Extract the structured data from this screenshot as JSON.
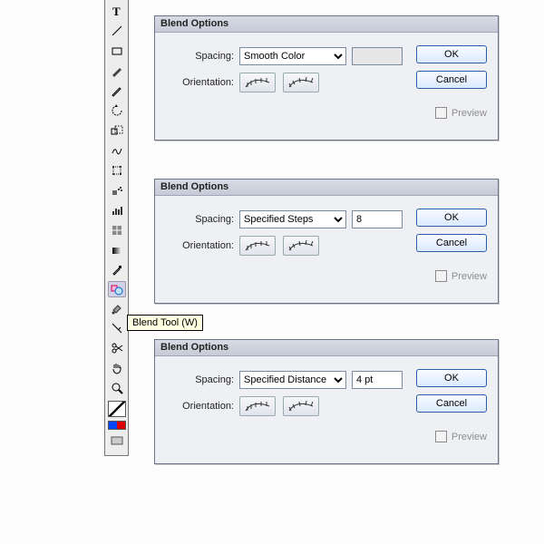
{
  "tooltip": "Blend Tool (W)",
  "dialogs": [
    {
      "title": "Blend Options",
      "labels": {
        "spacing": "Spacing:",
        "orientation": "Orientation:"
      },
      "spacingOptions": [
        "Smooth Color",
        "Specified Steps",
        "Specified Distance"
      ],
      "spacingSelected": "Smooth Color",
      "value": "",
      "valueEnabled": false,
      "ok": "OK",
      "cancel": "Cancel",
      "preview": "Preview"
    },
    {
      "title": "Blend Options",
      "labels": {
        "spacing": "Spacing:",
        "orientation": "Orientation:"
      },
      "spacingOptions": [
        "Smooth Color",
        "Specified Steps",
        "Specified Distance"
      ],
      "spacingSelected": "Specified Steps",
      "value": "8",
      "valueEnabled": true,
      "ok": "OK",
      "cancel": "Cancel",
      "preview": "Preview"
    },
    {
      "title": "Blend Options",
      "labels": {
        "spacing": "Spacing:",
        "orientation": "Orientation:"
      },
      "spacingOptions": [
        "Smooth Color",
        "Specified Steps",
        "Specified Distance"
      ],
      "spacingSelected": "Specified Distance",
      "value": "4 pt",
      "valueEnabled": true,
      "ok": "OK",
      "cancel": "Cancel",
      "preview": "Preview"
    }
  ],
  "tools": [
    "type-tool",
    "line-tool",
    "rectangle-tool",
    "paintbrush-tool",
    "pencil-tool",
    "rotate-tool",
    "scale-tool",
    "reflect-tool",
    "free-transform-tool",
    "symbol-sprayer-tool",
    "graph-tool",
    "mesh-tool",
    "gradient-tool",
    "eyedropper-tool",
    "blend-tool",
    "live-paint-tool",
    "slice-tool",
    "scissors-tool",
    "hand-tool",
    "zoom-tool"
  ],
  "selectedTool": "blend-tool"
}
